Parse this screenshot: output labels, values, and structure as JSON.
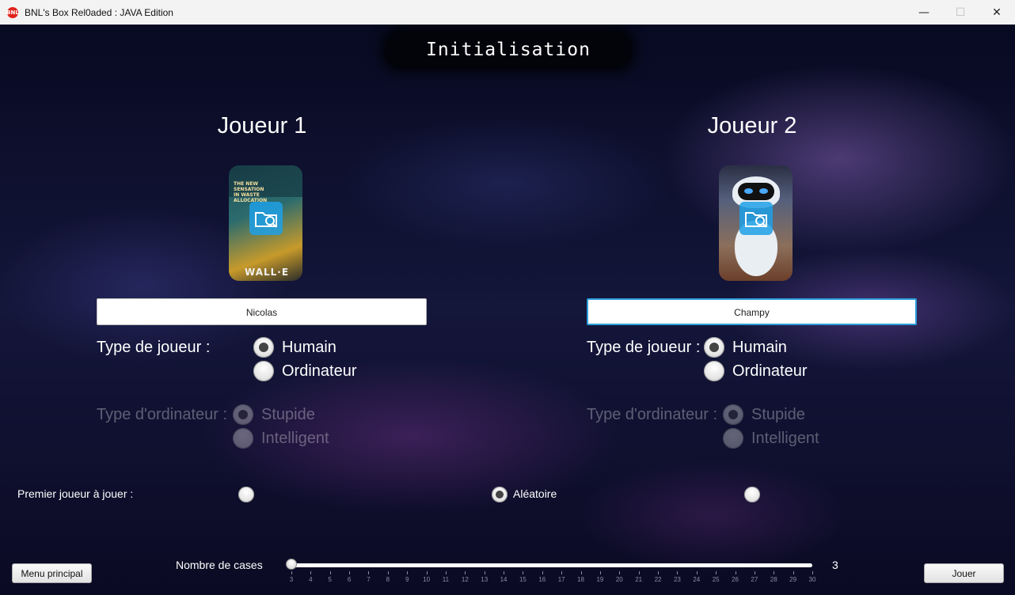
{
  "window": {
    "title": "BNL's Box Rel0aded : JAVA Edition",
    "app_icon_text": "BNL",
    "minimize": "—",
    "maximize": "☐",
    "close": "✕"
  },
  "header": {
    "title": "Initialisation"
  },
  "player1": {
    "title": "Joueur 1",
    "avatar_text": "THE NEW SENSATION IN WASTE ALLOCATION",
    "avatar_logo": "WALL·E",
    "name": "Nicolas",
    "type_label": "Type de joueur :",
    "type_options": [
      "Humain",
      "Ordinateur"
    ],
    "type_selected": "Humain",
    "ai_label": "Type d'ordinateur :",
    "ai_options": [
      "Stupide",
      "Intelligent"
    ],
    "ai_selected": "Stupide"
  },
  "player2": {
    "title": "Joueur 2",
    "name": "Champy",
    "type_label": "Type de joueur :",
    "type_options": [
      "Humain",
      "Ordinateur"
    ],
    "type_selected": "Humain",
    "ai_label": "Type d'ordinateur :",
    "ai_options": [
      "Stupide",
      "Intelligent"
    ],
    "ai_selected": "Stupide"
  },
  "first_player": {
    "label": "Premier joueur à jouer :",
    "random_label": "Aléatoire",
    "selected": "Aléatoire"
  },
  "board_size": {
    "label": "Nombre de cases",
    "value": "3",
    "min": 3,
    "max": 30,
    "ticks": [
      "3",
      "4",
      "5",
      "6",
      "7",
      "8",
      "9",
      "10",
      "11",
      "12",
      "13",
      "14",
      "15",
      "16",
      "17",
      "18",
      "19",
      "20",
      "21",
      "22",
      "23",
      "24",
      "25",
      "26",
      "27",
      "28",
      "29",
      "30"
    ]
  },
  "buttons": {
    "main_menu": "Menu principal",
    "play": "Jouer"
  },
  "icons": {
    "folder_search": "folder-search-icon"
  },
  "colors": {
    "focus": "#2b9cd8",
    "accent_folder": "#1ea0e6"
  }
}
